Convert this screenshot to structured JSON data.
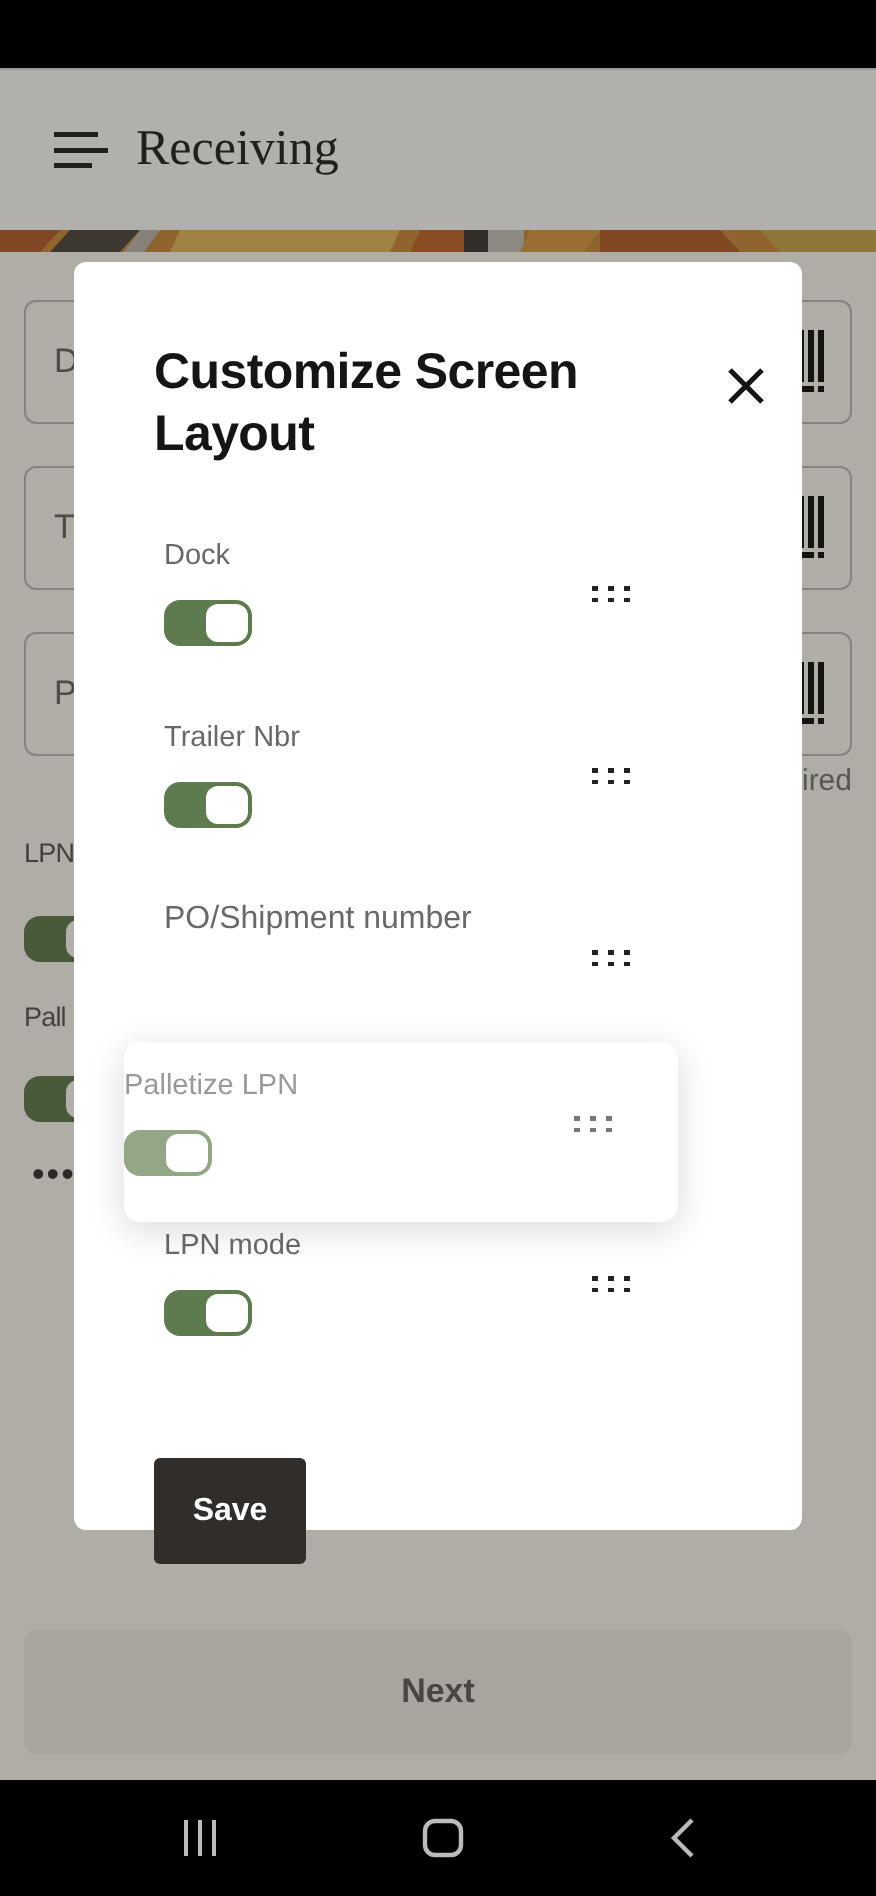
{
  "app_bar": {
    "title": "Receiving"
  },
  "form": {
    "fields": [
      {
        "label": "D"
      },
      {
        "label": "T"
      },
      {
        "label": "P"
      }
    ],
    "note": "ired",
    "toggles": [
      {
        "label": "LPN",
        "on": true
      },
      {
        "label": "Pall",
        "on": true
      }
    ],
    "more": "•••"
  },
  "next_button": {
    "label": "Next",
    "disabled": true
  },
  "dialog": {
    "title": "Customize Screen Layout",
    "items": [
      {
        "label": "Dock",
        "kind": "toggle",
        "on": true,
        "dragging": false
      },
      {
        "label": "Trailer Nbr",
        "kind": "toggle",
        "on": true,
        "dragging": false
      },
      {
        "label": "PO/Shipment number",
        "kind": "text",
        "dragging": false
      },
      {
        "label": "Palletize LPN",
        "kind": "toggle",
        "on": true,
        "dragging": true
      },
      {
        "label": "LPN mode",
        "kind": "toggle",
        "on": true,
        "dragging": false
      }
    ],
    "save": "Save"
  }
}
